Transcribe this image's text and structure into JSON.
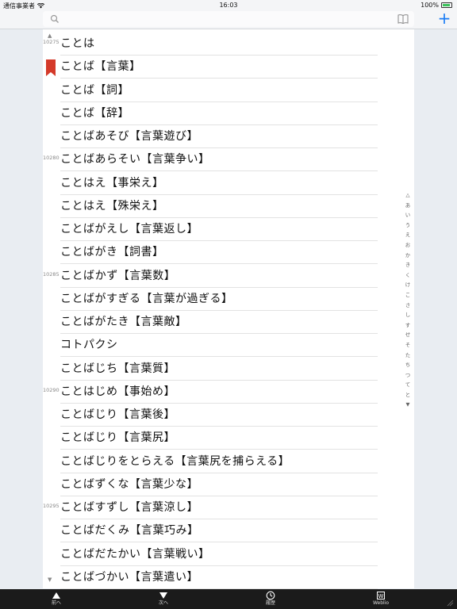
{
  "status": {
    "carrier": "通信事業者",
    "time": "16:03",
    "battery": "100%"
  },
  "search": {
    "placeholder": "",
    "value": ""
  },
  "toolbar": {
    "plus_label": "+"
  },
  "entries": [
    {
      "num": "10275",
      "word": "ことは",
      "bookmark": false
    },
    {
      "num": "",
      "word": "ことば【言葉】",
      "bookmark": true
    },
    {
      "num": "",
      "word": "ことば【詞】",
      "bookmark": false
    },
    {
      "num": "",
      "word": "ことば【辞】",
      "bookmark": false
    },
    {
      "num": "",
      "word": "ことばあそび【言葉遊び】",
      "bookmark": false
    },
    {
      "num": "10280",
      "word": "ことばあらそい【言葉争い】",
      "bookmark": false
    },
    {
      "num": "",
      "word": "ことはえ【事栄え】",
      "bookmark": false
    },
    {
      "num": "",
      "word": "ことはえ【殊栄え】",
      "bookmark": false
    },
    {
      "num": "",
      "word": "ことばがえし【言葉返し】",
      "bookmark": false
    },
    {
      "num": "",
      "word": "ことばがき【詞書】",
      "bookmark": false
    },
    {
      "num": "10285",
      "word": "ことばかず【言葉数】",
      "bookmark": false
    },
    {
      "num": "",
      "word": "ことばがすぎる【言葉が過ぎる】",
      "bookmark": false
    },
    {
      "num": "",
      "word": "ことばがたき【言葉敵】",
      "bookmark": false
    },
    {
      "num": "",
      "word": "コトパクシ",
      "bookmark": false
    },
    {
      "num": "",
      "word": "ことばじち【言葉質】",
      "bookmark": false
    },
    {
      "num": "10290",
      "word": "ことはじめ【事始め】",
      "bookmark": false
    },
    {
      "num": "",
      "word": "ことばじり【言葉後】",
      "bookmark": false
    },
    {
      "num": "",
      "word": "ことばじり【言葉尻】",
      "bookmark": false
    },
    {
      "num": "",
      "word": "ことばじりをとらえる【言葉尻を捕らえる】",
      "bookmark": false
    },
    {
      "num": "",
      "word": "ことばずくな【言葉少な】",
      "bookmark": false
    },
    {
      "num": "10295",
      "word": "ことばすずし【言葉涼し】",
      "bookmark": false
    },
    {
      "num": "",
      "word": "ことばだくみ【言葉巧み】",
      "bookmark": false
    },
    {
      "num": "",
      "word": "ことばだたかい【言葉戦い】",
      "bookmark": false
    },
    {
      "num": "",
      "word": "ことばづかい【言葉遣い】",
      "bookmark": false
    }
  ],
  "scroll": {
    "up": "▲",
    "down": "▼"
  },
  "index": [
    "△",
    "あ",
    "い",
    "う",
    "え",
    "お",
    "か",
    "き",
    "く",
    "け",
    "こ",
    "さ",
    "し",
    "す",
    "せ",
    "そ",
    "た",
    "ち",
    "つ",
    "て",
    "と",
    "▼"
  ],
  "bottom": {
    "prev": "前へ",
    "next": "次へ",
    "history": "履歴",
    "weblio": "Weblio"
  },
  "colors": {
    "accent": "#1a7cf5",
    "bookmark": "#d43a2a"
  }
}
